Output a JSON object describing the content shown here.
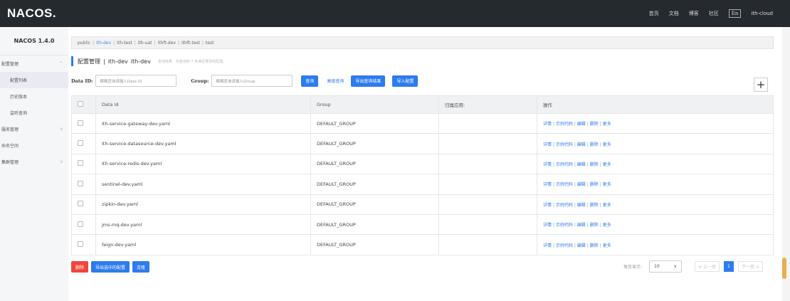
{
  "header": {
    "logo": "NACOS.",
    "nav": [
      "首页",
      "文档",
      "博客",
      "社区"
    ],
    "lang": "En",
    "user": "ith-cloud"
  },
  "sidebar": {
    "version": "NACOS 1.4.0",
    "items": [
      {
        "label": "配置管理",
        "type": "group",
        "chevron": "^"
      },
      {
        "label": "配置列表",
        "type": "sub",
        "active": true
      },
      {
        "label": "历史版本",
        "type": "sub"
      },
      {
        "label": "监听查询",
        "type": "sub"
      },
      {
        "label": "服务管理",
        "type": "group",
        "chevron": "v"
      },
      {
        "label": "命名空间",
        "type": "group"
      },
      {
        "label": "集群管理",
        "type": "group",
        "chevron": "v"
      }
    ]
  },
  "namespaces": {
    "items": [
      "public",
      "ith-dev",
      "ith-test",
      "ith-uat",
      "ithft-dev",
      "ithft-test",
      "test"
    ],
    "active": "ith-dev"
  },
  "page": {
    "title": "配置管理",
    "sep": "|",
    "ns_name": "ith-dev",
    "ns_id": "ith-dev",
    "hint": "查询结果：共查询到 7 条满足要求的配置。"
  },
  "search": {
    "dataid_label": "Data ID:",
    "dataid_placeholder": "模糊查询请输入Data ID",
    "group_label": "Group:",
    "group_placeholder": "模糊查询请输入Group",
    "query_btn": "查询",
    "advanced": "高级查询",
    "export_query": "导出查询结果",
    "import": "导入配置",
    "add": "+"
  },
  "table": {
    "headers": [
      "Data Id",
      "Group",
      "归属应用:",
      "操作"
    ],
    "rows": [
      {
        "dataId": "ith-service-gateway-dev.yaml",
        "group": "DEFAULT_GROUP",
        "app": ""
      },
      {
        "dataId": "ith-service-datasource-dev.yaml",
        "group": "DEFAULT_GROUP",
        "app": ""
      },
      {
        "dataId": "ith-service-redis-dev.yaml",
        "group": "DEFAULT_GROUP",
        "app": ""
      },
      {
        "dataId": "sentinel-dev.yaml",
        "group": "DEFAULT_GROUP",
        "app": ""
      },
      {
        "dataId": "zipkin-dev.yaml",
        "group": "DEFAULT_GROUP",
        "app": ""
      },
      {
        "dataId": "jms-mq-dev.yaml",
        "group": "DEFAULT_GROUP",
        "app": ""
      },
      {
        "dataId": "feign-dev.yaml",
        "group": "DEFAULT_GROUP",
        "app": ""
      }
    ],
    "ops": [
      "详情",
      "示例代码",
      "编辑",
      "删除",
      "更多"
    ]
  },
  "bottom": {
    "delete": "删除",
    "export_selected": "导出选中的配置",
    "clone": "克隆"
  },
  "pager": {
    "per_page_label": "每页显示：",
    "per_page": "10",
    "prev": "< 上一页",
    "current": "1",
    "next": "下一页 >"
  },
  "colors": {
    "accent": "#2d7bf0",
    "danger": "#f0463c",
    "topbar": "#252a2f"
  }
}
